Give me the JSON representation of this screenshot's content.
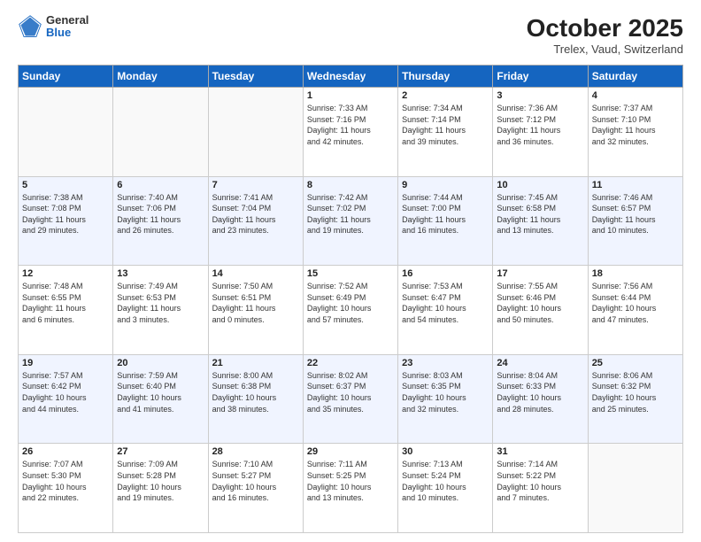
{
  "header": {
    "title": "October 2025",
    "subtitle": "Trelex, Vaud, Switzerland",
    "logo_general": "General",
    "logo_blue": "Blue"
  },
  "days_of_week": [
    "Sunday",
    "Monday",
    "Tuesday",
    "Wednesday",
    "Thursday",
    "Friday",
    "Saturday"
  ],
  "weeks": [
    {
      "alt": false,
      "days": [
        {
          "num": "",
          "info": ""
        },
        {
          "num": "",
          "info": ""
        },
        {
          "num": "",
          "info": ""
        },
        {
          "num": "1",
          "info": "Sunrise: 7:33 AM\nSunset: 7:16 PM\nDaylight: 11 hours\nand 42 minutes."
        },
        {
          "num": "2",
          "info": "Sunrise: 7:34 AM\nSunset: 7:14 PM\nDaylight: 11 hours\nand 39 minutes."
        },
        {
          "num": "3",
          "info": "Sunrise: 7:36 AM\nSunset: 7:12 PM\nDaylight: 11 hours\nand 36 minutes."
        },
        {
          "num": "4",
          "info": "Sunrise: 7:37 AM\nSunset: 7:10 PM\nDaylight: 11 hours\nand 32 minutes."
        }
      ]
    },
    {
      "alt": true,
      "days": [
        {
          "num": "5",
          "info": "Sunrise: 7:38 AM\nSunset: 7:08 PM\nDaylight: 11 hours\nand 29 minutes."
        },
        {
          "num": "6",
          "info": "Sunrise: 7:40 AM\nSunset: 7:06 PM\nDaylight: 11 hours\nand 26 minutes."
        },
        {
          "num": "7",
          "info": "Sunrise: 7:41 AM\nSunset: 7:04 PM\nDaylight: 11 hours\nand 23 minutes."
        },
        {
          "num": "8",
          "info": "Sunrise: 7:42 AM\nSunset: 7:02 PM\nDaylight: 11 hours\nand 19 minutes."
        },
        {
          "num": "9",
          "info": "Sunrise: 7:44 AM\nSunset: 7:00 PM\nDaylight: 11 hours\nand 16 minutes."
        },
        {
          "num": "10",
          "info": "Sunrise: 7:45 AM\nSunset: 6:58 PM\nDaylight: 11 hours\nand 13 minutes."
        },
        {
          "num": "11",
          "info": "Sunrise: 7:46 AM\nSunset: 6:57 PM\nDaylight: 11 hours\nand 10 minutes."
        }
      ]
    },
    {
      "alt": false,
      "days": [
        {
          "num": "12",
          "info": "Sunrise: 7:48 AM\nSunset: 6:55 PM\nDaylight: 11 hours\nand 6 minutes."
        },
        {
          "num": "13",
          "info": "Sunrise: 7:49 AM\nSunset: 6:53 PM\nDaylight: 11 hours\nand 3 minutes."
        },
        {
          "num": "14",
          "info": "Sunrise: 7:50 AM\nSunset: 6:51 PM\nDaylight: 11 hours\nand 0 minutes."
        },
        {
          "num": "15",
          "info": "Sunrise: 7:52 AM\nSunset: 6:49 PM\nDaylight: 10 hours\nand 57 minutes."
        },
        {
          "num": "16",
          "info": "Sunrise: 7:53 AM\nSunset: 6:47 PM\nDaylight: 10 hours\nand 54 minutes."
        },
        {
          "num": "17",
          "info": "Sunrise: 7:55 AM\nSunset: 6:46 PM\nDaylight: 10 hours\nand 50 minutes."
        },
        {
          "num": "18",
          "info": "Sunrise: 7:56 AM\nSunset: 6:44 PM\nDaylight: 10 hours\nand 47 minutes."
        }
      ]
    },
    {
      "alt": true,
      "days": [
        {
          "num": "19",
          "info": "Sunrise: 7:57 AM\nSunset: 6:42 PM\nDaylight: 10 hours\nand 44 minutes."
        },
        {
          "num": "20",
          "info": "Sunrise: 7:59 AM\nSunset: 6:40 PM\nDaylight: 10 hours\nand 41 minutes."
        },
        {
          "num": "21",
          "info": "Sunrise: 8:00 AM\nSunset: 6:38 PM\nDaylight: 10 hours\nand 38 minutes."
        },
        {
          "num": "22",
          "info": "Sunrise: 8:02 AM\nSunset: 6:37 PM\nDaylight: 10 hours\nand 35 minutes."
        },
        {
          "num": "23",
          "info": "Sunrise: 8:03 AM\nSunset: 6:35 PM\nDaylight: 10 hours\nand 32 minutes."
        },
        {
          "num": "24",
          "info": "Sunrise: 8:04 AM\nSunset: 6:33 PM\nDaylight: 10 hours\nand 28 minutes."
        },
        {
          "num": "25",
          "info": "Sunrise: 8:06 AM\nSunset: 6:32 PM\nDaylight: 10 hours\nand 25 minutes."
        }
      ]
    },
    {
      "alt": false,
      "days": [
        {
          "num": "26",
          "info": "Sunrise: 7:07 AM\nSunset: 5:30 PM\nDaylight: 10 hours\nand 22 minutes."
        },
        {
          "num": "27",
          "info": "Sunrise: 7:09 AM\nSunset: 5:28 PM\nDaylight: 10 hours\nand 19 minutes."
        },
        {
          "num": "28",
          "info": "Sunrise: 7:10 AM\nSunset: 5:27 PM\nDaylight: 10 hours\nand 16 minutes."
        },
        {
          "num": "29",
          "info": "Sunrise: 7:11 AM\nSunset: 5:25 PM\nDaylight: 10 hours\nand 13 minutes."
        },
        {
          "num": "30",
          "info": "Sunrise: 7:13 AM\nSunset: 5:24 PM\nDaylight: 10 hours\nand 10 minutes."
        },
        {
          "num": "31",
          "info": "Sunrise: 7:14 AM\nSunset: 5:22 PM\nDaylight: 10 hours\nand 7 minutes."
        },
        {
          "num": "",
          "info": ""
        }
      ]
    }
  ]
}
